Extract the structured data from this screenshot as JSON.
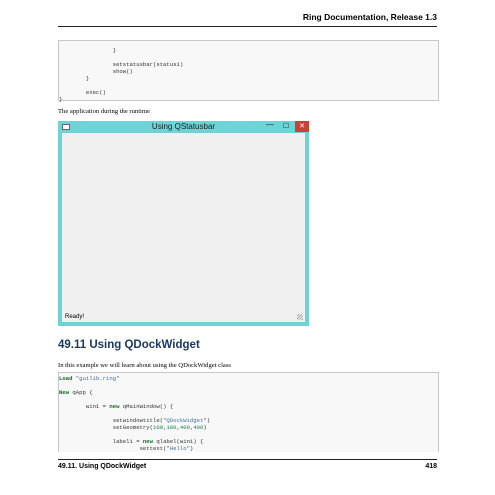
{
  "header": {
    "title": "Ring Documentation, Release 1.3"
  },
  "code_top": {
    "lines": [
      "                }",
      "",
      "                setstatusbar(status1)",
      "                show()",
      "        }",
      "",
      "        exec()",
      "}"
    ]
  },
  "runtime_caption": "The application during the runtime",
  "app_window": {
    "title": "Using QStatusbar",
    "minimize": "—",
    "maximize": "☐",
    "close": "✕",
    "status": "Ready!"
  },
  "section": {
    "heading": "49.11  Using QDockWidget",
    "intro": "In this example we will learn about using the QDockWidget class"
  },
  "code_bottom": {
    "l1_kw": "Load",
    "l1_str": "\"guilib.ring\"",
    "l2_kw": "New",
    "l2_rest": " qApp {",
    "l3_a": "        win1 = ",
    "l3_kw": "new",
    "l3_b": " qMainWindow() {",
    "l4_a": "                setwindowtitle(",
    "l4_str": "\"QDockWidget\"",
    "l4_b": ")",
    "l5_a": "                setGeometry(",
    "l5_n1": "100",
    "l5_c1": ",",
    "l5_n2": "100",
    "l5_c2": ",",
    "l5_n3": "400",
    "l5_c3": ",",
    "l5_n4": "400",
    "l5_b": ")",
    "l6_a": "                label1 = ",
    "l6_kw": "new",
    "l6_b": " qlabel(win1) {",
    "l7_a": "                        settext(",
    "l7_str": "\"Hello\"",
    "l7_b": ")"
  },
  "footer": {
    "section": "49.11.  Using QDockWidget",
    "page": "418"
  }
}
